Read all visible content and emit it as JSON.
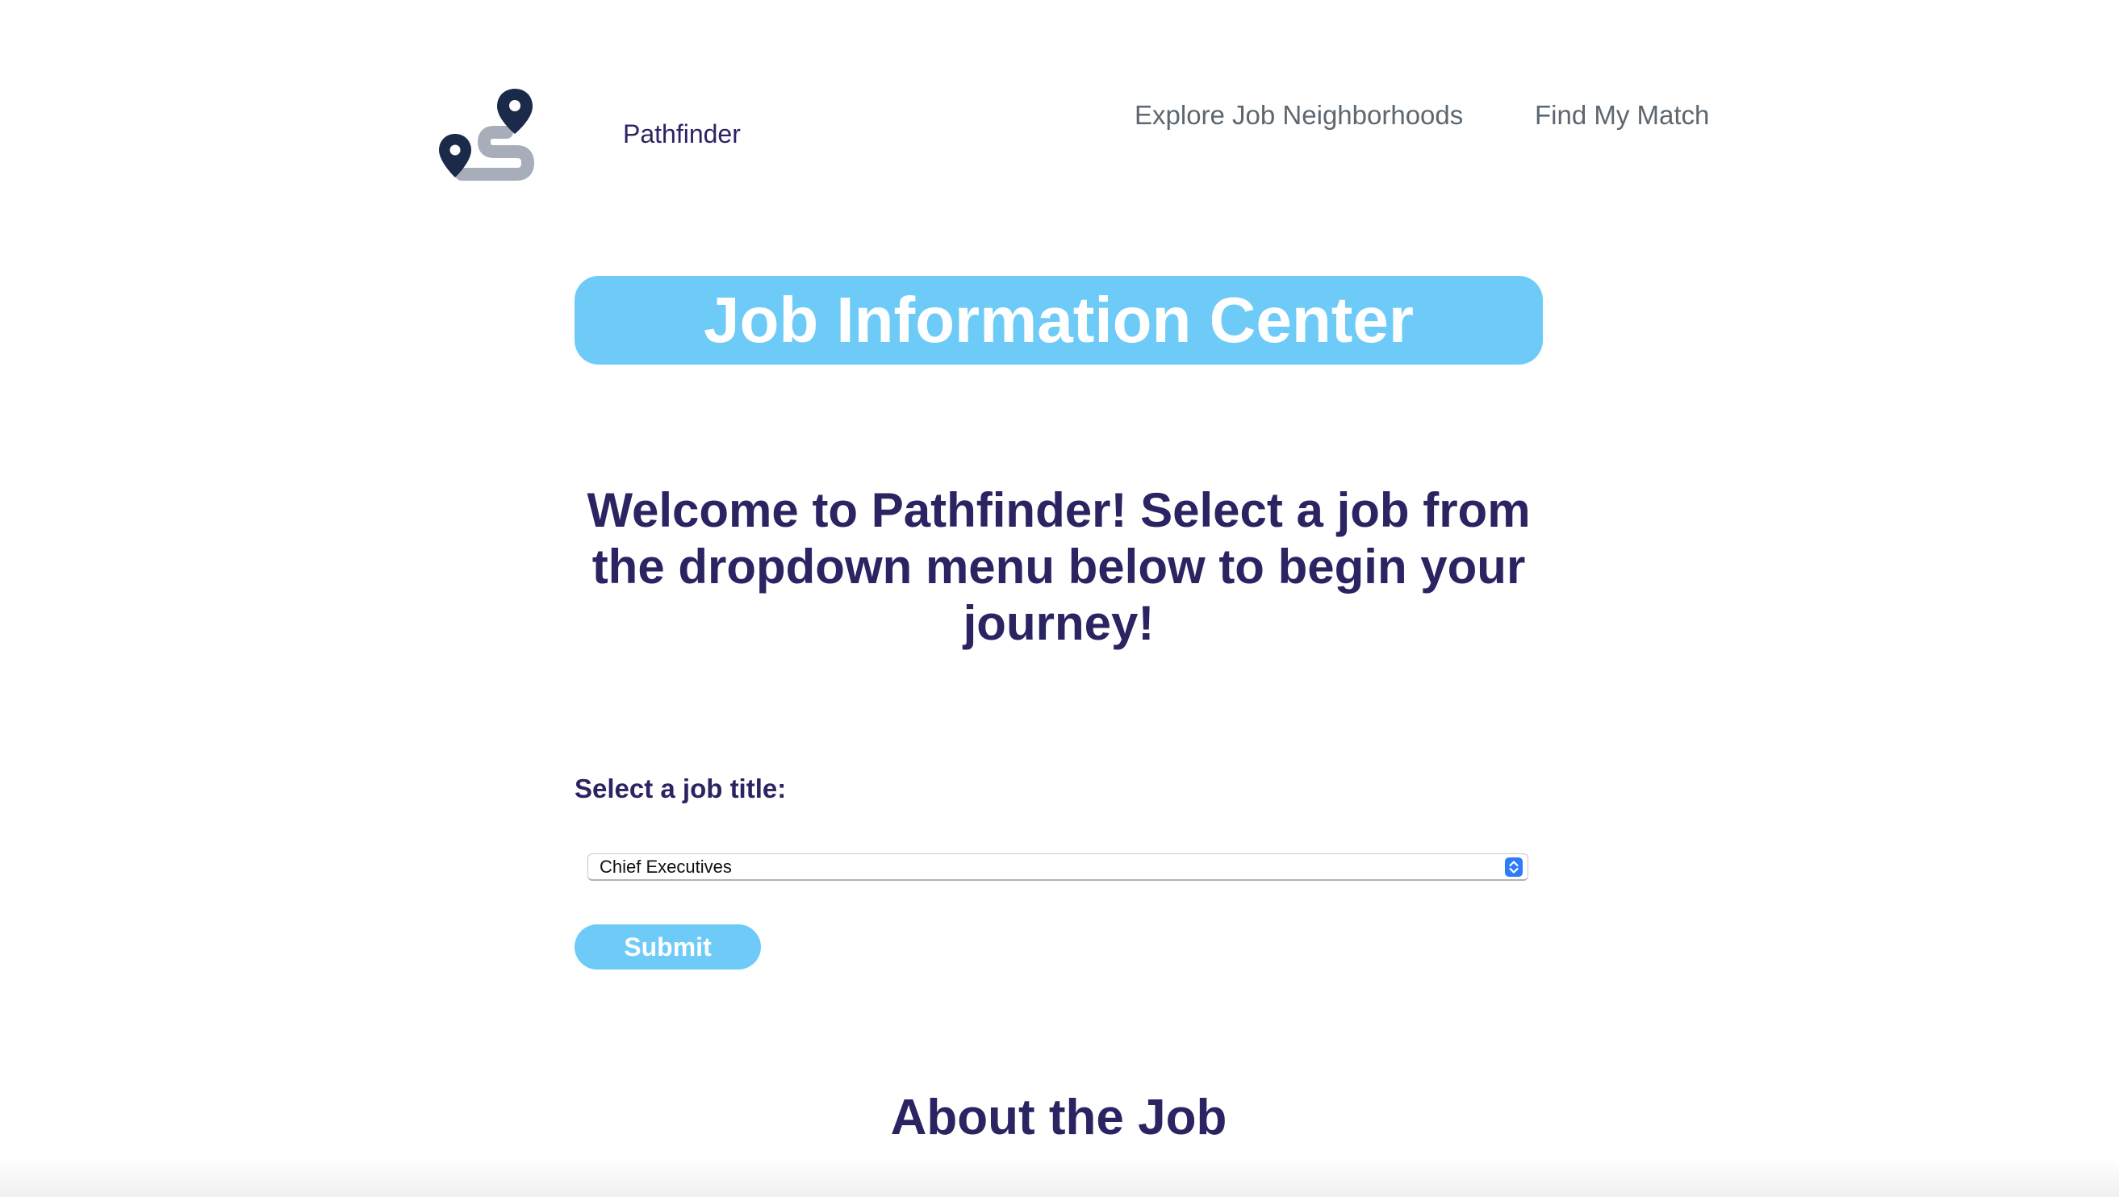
{
  "header": {
    "brand": "Pathfinder",
    "nav": [
      {
        "label": "Explore Job Neighborhoods"
      },
      {
        "label": "Find My Match"
      }
    ],
    "logo_icon": "map-route-pins-icon"
  },
  "banner": {
    "title": "Job Information Center"
  },
  "welcome": {
    "text": "Welcome to Pathfinder! Select a job from the dropdown menu below to begin your journey!"
  },
  "form": {
    "label": "Select a job title:",
    "selected_value": "Chief Executives",
    "submit_label": "Submit"
  },
  "about": {
    "heading": "About the Job"
  },
  "colors": {
    "accent": "#6ecbf8",
    "heading": "#2b2462",
    "nav_text": "#5c6770",
    "logo_pin": "#1c2a4a",
    "logo_path": "#a8adba",
    "select_arrows": "#2f7df6"
  }
}
